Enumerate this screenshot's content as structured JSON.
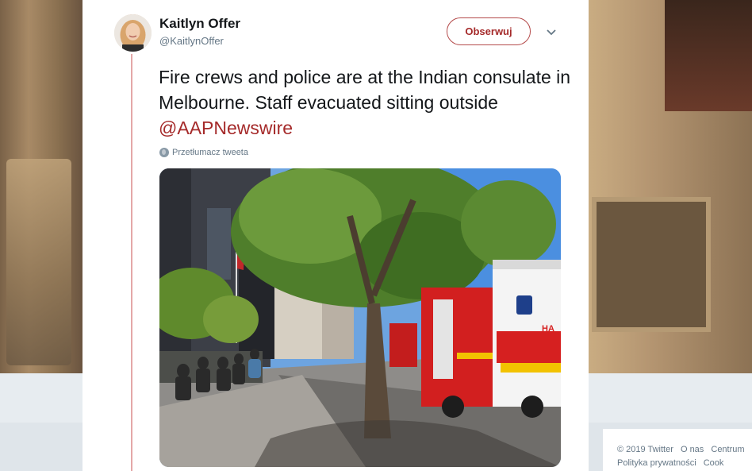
{
  "tweet": {
    "author_name": "Kaitlyn Offer",
    "author_handle": "@KaitlynOffer",
    "follow_label": "Obserwuj",
    "text_before": "Fire crews and police are at the Indian consulate in Melbourne. Staff evacuated sitting outside ",
    "mention": "@AAPNewswire",
    "translate_label": "Przetłumacz tweeta",
    "photo_truck_label": "HA"
  },
  "footer": {
    "copyright": "© 2019 Twitter",
    "about": "O nas",
    "help": "Centrum",
    "privacy": "Polityka prywatności",
    "cookies": "Cook"
  },
  "colors": {
    "accent": "#a52a2a",
    "thread_line": "#e4a8a8",
    "muted_text": "#657786"
  }
}
